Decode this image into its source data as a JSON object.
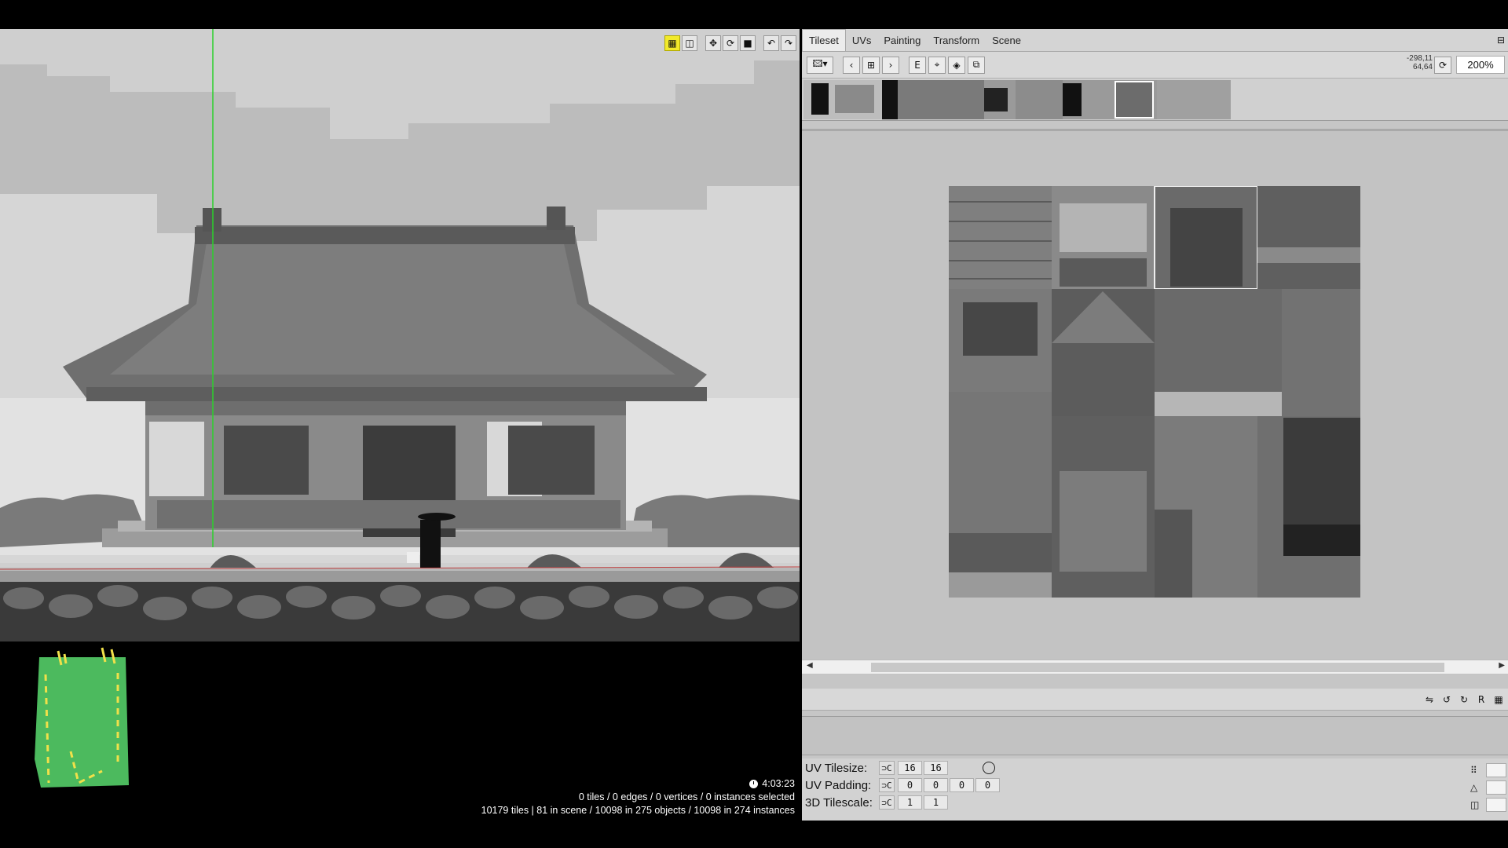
{
  "viewport": {
    "toolbar_icons": [
      "grid-icon",
      "cube-icon",
      "move-icon",
      "rotate-icon",
      "select-box-icon",
      "undo-icon",
      "redo-icon"
    ],
    "time": "4:03:23",
    "selection_status": "0 tiles / 0 edges / 0 vertices / 0 instances selected",
    "scene_stats": "10179 tiles | 81 in scene / 10098 in 275 objects / 10098 in 274 instances",
    "colors": {
      "sky": "#c8c8c8",
      "guide_line": "#2bd12b",
      "minimap_fill": "#4cba5e",
      "minimap_accent": "#f0e04a"
    }
  },
  "panel": {
    "tabs": [
      "Tileset",
      "UVs",
      "Painting",
      "Transform",
      "Scene"
    ],
    "active_tab": "Tileset",
    "toolbar": {
      "coordinates_line1": "-298,11",
      "coordinates_line2": "64,64",
      "zoom": "200%"
    },
    "uv_settings": {
      "tilesize_label": "UV Tilesize:",
      "tilesize": [
        "16",
        "16"
      ],
      "padding_label": "UV Padding:",
      "padding": [
        "0",
        "0",
        "0",
        "0"
      ],
      "tilescale_label": "3D Tilescale:",
      "tilescale": [
        "1",
        "1"
      ]
    }
  }
}
